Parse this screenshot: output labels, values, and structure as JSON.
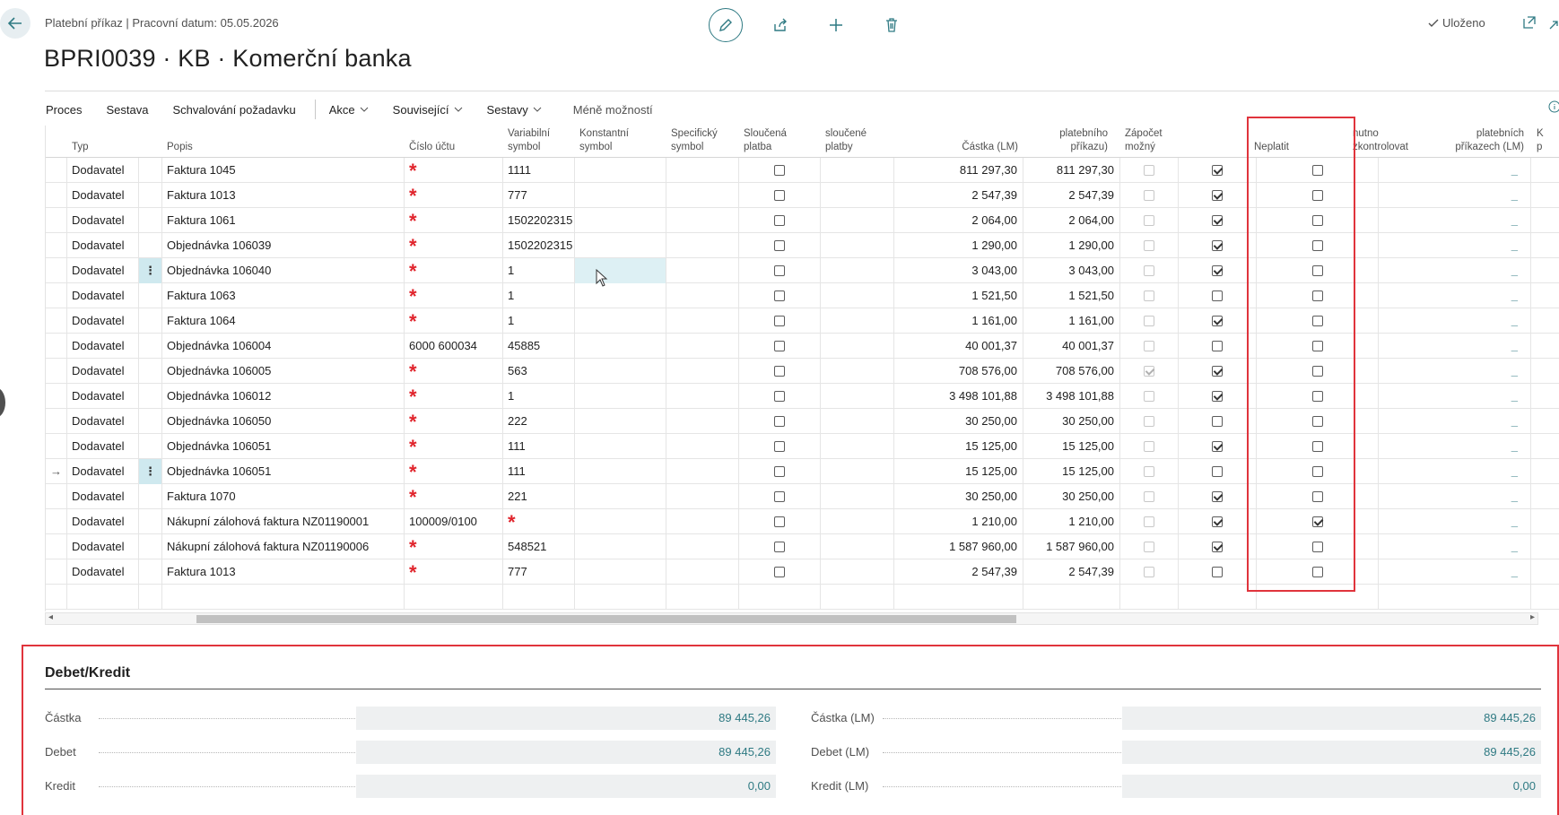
{
  "header": {
    "breadcrumb": "Platební příkaz | Pracovní datum: 05.05.2026",
    "title": "BPRI0039 · KB · Komerční banka",
    "saved_label": "Uloženo"
  },
  "action_bar": {
    "proces": "Proces",
    "sestava": "Sestava",
    "schvalovani": "Schvalování požadavku",
    "akce": "Akce",
    "souvisejici": "Související",
    "sestavy": "Sestavy",
    "less": "Méně možností"
  },
  "columns": {
    "typ": "Typ",
    "popis": "Popis",
    "cislo_uctu": "Číslo účtu",
    "variabilni_1": "Variabilní",
    "variabilni_2": "symbol",
    "konstantni_1": "Konstantní",
    "konstantni_2": "symbol",
    "specificky_1": "Specifický",
    "specificky_2": "symbol",
    "sloucena_1": "Sloučená",
    "sloucena_2": "platba",
    "sloucene_1": "sloučené",
    "sloucene_2": "platby",
    "castka_lm": "Částka (LM)",
    "platebniho_1": "platebního",
    "platebniho_2": "příkazu)",
    "zapocet_1": "Zápočet",
    "zapocet_2": "možný",
    "neplatit": "Neplatit",
    "nutno_1": "nutno",
    "nutno_2": "zkontrolovat",
    "platebnich_1": "platebních",
    "platebnich_2": "příkazech (LM)",
    "last_1": "K",
    "last_2": "p"
  },
  "rows": [
    {
      "typ": "Dodavatel",
      "popis": "Faktura 1045",
      "ucet": "",
      "var": "1111",
      "castka": "811 297,30",
      "prikaz": "811 297,30",
      "zapocet": false,
      "neplatit": true,
      "nutno": false
    },
    {
      "typ": "Dodavatel",
      "popis": "Faktura 1013",
      "ucet": "",
      "var": "777",
      "castka": "2 547,39",
      "prikaz": "2 547,39",
      "zapocet": false,
      "neplatit": true,
      "nutno": false
    },
    {
      "typ": "Dodavatel",
      "popis": "Faktura 1061",
      "ucet": "",
      "var": "1502202315",
      "castka": "2 064,00",
      "prikaz": "2 064,00",
      "zapocet": false,
      "neplatit": true,
      "nutno": false
    },
    {
      "typ": "Dodavatel",
      "popis": "Objednávka 106039",
      "ucet": "",
      "var": "1502202315",
      "castka": "1 290,00",
      "prikaz": "1 290,00",
      "zapocet": false,
      "neplatit": true,
      "nutno": false
    },
    {
      "typ": "Dodavatel",
      "popis": "Objednávka 106040",
      "ucet": "",
      "var": "1",
      "castka": "3 043,00",
      "prikaz": "3 043,00",
      "zapocet": false,
      "neplatit": true,
      "nutno": false
    },
    {
      "typ": "Dodavatel",
      "popis": "Faktura 1063",
      "ucet": "",
      "var": "1",
      "castka": "1 521,50",
      "prikaz": "1 521,50",
      "zapocet": false,
      "neplatit": false,
      "nutno": false
    },
    {
      "typ": "Dodavatel",
      "popis": "Faktura 1064",
      "ucet": "",
      "var": "1",
      "castka": "1 161,00",
      "prikaz": "1 161,00",
      "zapocet": false,
      "neplatit": true,
      "nutno": false
    },
    {
      "typ": "Dodavatel",
      "popis": "Objednávka 106004",
      "ucet": "6000 600034",
      "var": "45885",
      "castka": "40 001,37",
      "prikaz": "40 001,37",
      "zapocet": false,
      "neplatit": false,
      "nutno": false
    },
    {
      "typ": "Dodavatel",
      "popis": "Objednávka 106005",
      "ucet": "",
      "var": "563",
      "castka": "708 576,00",
      "prikaz": "708 576,00",
      "zapocet": true,
      "neplatit": true,
      "nutno": false
    },
    {
      "typ": "Dodavatel",
      "popis": "Objednávka 106012",
      "ucet": "",
      "var": "1",
      "castka": "3 498 101,88",
      "prikaz": "3 498 101,88",
      "zapocet": false,
      "neplatit": true,
      "nutno": false
    },
    {
      "typ": "Dodavatel",
      "popis": "Objednávka 106050",
      "ucet": "",
      "var": "222",
      "castka": "30 250,00",
      "prikaz": "30 250,00",
      "zapocet": false,
      "neplatit": false,
      "nutno": false
    },
    {
      "typ": "Dodavatel",
      "popis": "Objednávka 106051",
      "ucet": "",
      "var": "111",
      "castka": "15 125,00",
      "prikaz": "15 125,00",
      "zapocet": false,
      "neplatit": true,
      "nutno": false
    },
    {
      "typ": "Dodavatel",
      "popis": "Objednávka 106051",
      "ucet": "",
      "var": "111",
      "castka": "15 125,00",
      "prikaz": "15 125,00",
      "zapocet": false,
      "neplatit": false,
      "nutno": false
    },
    {
      "typ": "Dodavatel",
      "popis": "Faktura 1070",
      "ucet": "",
      "var": "221",
      "castka": "30 250,00",
      "prikaz": "30 250,00",
      "zapocet": false,
      "neplatit": true,
      "nutno": false
    },
    {
      "typ": "Dodavatel",
      "popis": "Nákupní zálohová faktura NZ01190001",
      "ucet": "100009/0100",
      "var": "",
      "castka": "1 210,00",
      "prikaz": "1 210,00",
      "zapocet": false,
      "neplatit": true,
      "nutno": true
    },
    {
      "typ": "Dodavatel",
      "popis": "Nákupní zálohová faktura NZ01190006",
      "ucet": "",
      "var": "548521",
      "castka": "1 587 960,00",
      "prikaz": "1 587 960,00",
      "zapocet": false,
      "neplatit": true,
      "nutno": false
    },
    {
      "typ": "Dodavatel",
      "popis": "Faktura 1013",
      "ucet": "",
      "var": "777",
      "castka": "2 547,39",
      "prikaz": "2 547,39",
      "zapocet": false,
      "neplatit": false,
      "nutno": false
    }
  ],
  "summary": {
    "title": "Debet/Kredit",
    "castka_label": "Částka",
    "castka_value": "89 445,26",
    "debet_label": "Debet",
    "debet_value": "89 445,26",
    "kredit_label": "Kredit",
    "kredit_value": "0,00",
    "castka_lm_label": "Částka (LM)",
    "castka_lm_value": "89 445,26",
    "debet_lm_label": "Debet (LM)",
    "debet_lm_value": "89 445,26",
    "kredit_lm_label": "Kredit (LM)",
    "kredit_lm_value": "0,00"
  },
  "colors": {
    "accent": "#2f7a83",
    "required": "#e0242c",
    "highlight": "#e0343c"
  }
}
